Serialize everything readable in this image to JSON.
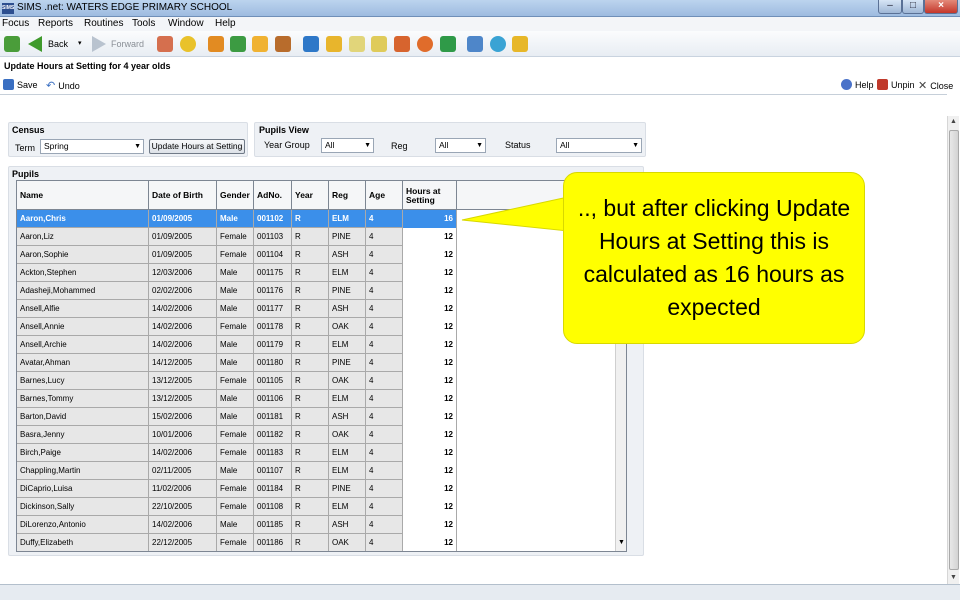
{
  "window": {
    "logo_text": "SIMS",
    "title": "SIMS .net: WATERS EDGE PRIMARY SCHOOL",
    "controls": [
      "–",
      "□",
      "×"
    ]
  },
  "menu": [
    "Focus",
    "Reports",
    "Routines",
    "Tools",
    "Window",
    "Help"
  ],
  "toolbar": {
    "back_label": "Back",
    "forward_label": "Forward",
    "icon_names": [
      "home-icon",
      "back-arrow-icon",
      "dropdown-icon",
      "forward-arrow-icon",
      "pupils-icon",
      "bulb-icon",
      "book-icon",
      "flag-icon",
      "card-icon",
      "person-icon",
      "chart-icon",
      "folder-icon",
      "document-icon",
      "edit-icon",
      "people-icon",
      "clock-icon",
      "refresh-icon",
      "report-icon",
      "globe-icon",
      "export-icon"
    ]
  },
  "page": {
    "title": "Update Hours at Setting for 4 year olds",
    "save_label": "Save",
    "undo_label": "Undo",
    "help_label": "Help",
    "unpin_label": "Unpin",
    "close_label": "Close"
  },
  "census": {
    "heading": "Census",
    "term_label": "Term",
    "term_value": "Spring",
    "update_button": "Update Hours at Setting"
  },
  "pupils_view": {
    "heading": "Pupils View",
    "year_group_label": "Year Group",
    "year_group_value": "All",
    "reg_label": "Reg",
    "reg_value": "All",
    "status_label": "Status",
    "status_value": "All"
  },
  "pupils": {
    "heading": "Pupils",
    "columns": [
      "Name",
      "Date of Birth",
      "Gender",
      "AdNo.",
      "Year",
      "Reg",
      "Age",
      "Hours at Setting"
    ],
    "selected_index": 0,
    "rows": [
      [
        "Aaron,Chris",
        "01/09/2005",
        "Male",
        "001102",
        "R",
        "ELM",
        "4",
        "16"
      ],
      [
        "Aaron,Liz",
        "01/09/2005",
        "Female",
        "001103",
        "R",
        "PINE",
        "4",
        "12"
      ],
      [
        "Aaron,Sophie",
        "01/09/2005",
        "Female",
        "001104",
        "R",
        "ASH",
        "4",
        "12"
      ],
      [
        "Ackton,Stephen",
        "12/03/2006",
        "Male",
        "001175",
        "R",
        "ELM",
        "4",
        "12"
      ],
      [
        "Adasheji,Mohammed",
        "02/02/2006",
        "Male",
        "001176",
        "R",
        "PINE",
        "4",
        "12"
      ],
      [
        "Ansell,Alfie",
        "14/02/2006",
        "Male",
        "001177",
        "R",
        "ASH",
        "4",
        "12"
      ],
      [
        "Ansell,Annie",
        "14/02/2006",
        "Female",
        "001178",
        "R",
        "OAK",
        "4",
        "12"
      ],
      [
        "Ansell,Archie",
        "14/02/2006",
        "Male",
        "001179",
        "R",
        "ELM",
        "4",
        "12"
      ],
      [
        "Avatar,Ahman",
        "14/12/2005",
        "Male",
        "001180",
        "R",
        "PINE",
        "4",
        "12"
      ],
      [
        "Barnes,Lucy",
        "13/12/2005",
        "Female",
        "001105",
        "R",
        "OAK",
        "4",
        "12"
      ],
      [
        "Barnes,Tommy",
        "13/12/2005",
        "Male",
        "001106",
        "R",
        "ELM",
        "4",
        "12"
      ],
      [
        "Barton,David",
        "15/02/2006",
        "Male",
        "001181",
        "R",
        "ASH",
        "4",
        "12"
      ],
      [
        "Basra,Jenny",
        "10/01/2006",
        "Female",
        "001182",
        "R",
        "OAK",
        "4",
        "12"
      ],
      [
        "Birch,Paige",
        "14/02/2006",
        "Female",
        "001183",
        "R",
        "ELM",
        "4",
        "12"
      ],
      [
        "Chappling,Martin",
        "02/11/2005",
        "Male",
        "001107",
        "R",
        "ELM",
        "4",
        "12"
      ],
      [
        "DiCaprio,Luisa",
        "11/02/2006",
        "Female",
        "001184",
        "R",
        "PINE",
        "4",
        "12"
      ],
      [
        "Dickinson,Sally",
        "22/10/2005",
        "Female",
        "001108",
        "R",
        "ELM",
        "4",
        "12"
      ],
      [
        "DiLorenzo,Antonio",
        "14/02/2006",
        "Male",
        "001185",
        "R",
        "ASH",
        "4",
        "12"
      ],
      [
        "Duffy,Elizabeth",
        "22/12/2005",
        "Female",
        "001186",
        "R",
        "OAK",
        "4",
        "12"
      ]
    ]
  },
  "callout": {
    "text": ".., but after clicking Update Hours at Setting this is calculated as 16 hours as expected"
  },
  "colors": {
    "selected_row": "#3b8fea",
    "callout_fill": "#ffff00",
    "row_fill": "#e7e7e7"
  }
}
